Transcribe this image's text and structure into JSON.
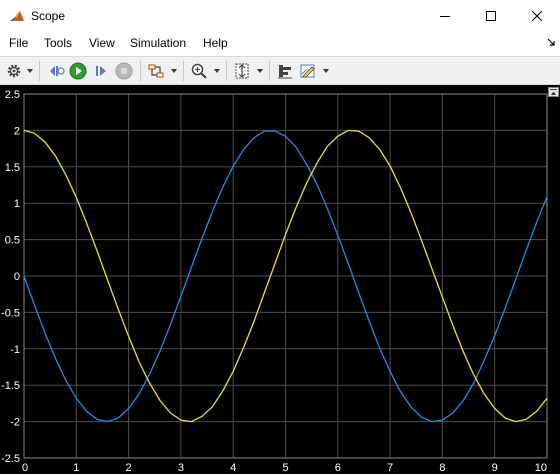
{
  "window": {
    "title": "Scope",
    "icon": "matlab-scope-icon",
    "controls": [
      "minimize-icon",
      "maximize-icon",
      "close-icon"
    ]
  },
  "menu": {
    "items": [
      {
        "label": "File"
      },
      {
        "label": "Tools"
      },
      {
        "label": "View"
      },
      {
        "label": "Simulation"
      },
      {
        "label": "Help"
      }
    ]
  },
  "toolbar": {
    "buttons": [
      {
        "icon": "gear-icon",
        "has_dropdown": true
      },
      {
        "icon": "step-back-icon"
      },
      {
        "icon": "run-icon",
        "color": "#2e9e2e"
      },
      {
        "icon": "step-forward-icon"
      },
      {
        "icon": "stop-icon",
        "enabled": false
      },
      {
        "icon": "signal-highlight-icon",
        "has_dropdown": true
      },
      {
        "icon": "zoom-icon",
        "has_dropdown": true
      },
      {
        "icon": "scale-axes-icon",
        "has_dropdown": true
      },
      {
        "icon": "cursor-measurements-icon"
      },
      {
        "icon": "style-edit-icon",
        "has_dropdown": true
      }
    ]
  },
  "colors": {
    "background": "#000000",
    "grid": "#4d4d4d",
    "axis_text": "#ffffff",
    "series_1": "#1e8ee6",
    "series_2": "#e6e62e"
  },
  "chart_data": {
    "type": "line",
    "xlim": [
      0,
      10
    ],
    "ylim": [
      -2.5,
      2.5
    ],
    "xticks": [
      "0",
      "1",
      "2",
      "3",
      "4",
      "5",
      "6",
      "7",
      "8",
      "9",
      "10"
    ],
    "yticks": [
      "2.5",
      "2",
      "1.5",
      "1",
      "0.5",
      "0",
      "-0.5",
      "-1",
      "-1.5",
      "-2",
      "-2.5"
    ],
    "grid": true,
    "series": [
      {
        "color": "#1e8ee6",
        "x": [
          0,
          0.2,
          0.4,
          0.6,
          0.8,
          1,
          1.2,
          1.4,
          1.6,
          1.8,
          2,
          2.2,
          2.4,
          2.6,
          2.8,
          3,
          3.2,
          3.4,
          3.6,
          3.8,
          4,
          4.2,
          4.4,
          4.6,
          4.8,
          5,
          5.2,
          5.4,
          5.6,
          5.8,
          6,
          6.2,
          6.4,
          6.6,
          6.8,
          7,
          7.2,
          7.4,
          7.6,
          7.8,
          8,
          8.2,
          8.4,
          8.6,
          8.8,
          9,
          9.2,
          9.4,
          9.6,
          9.8,
          10
        ],
        "y": [
          0,
          -0.4,
          -0.78,
          -1.13,
          -1.43,
          -1.68,
          -1.86,
          -1.97,
          -2,
          -1.95,
          -1.82,
          -1.62,
          -1.35,
          -1.03,
          -0.67,
          -0.28,
          0.12,
          0.51,
          0.88,
          1.22,
          1.51,
          1.74,
          1.9,
          1.99,
          1.99,
          1.92,
          1.77,
          1.54,
          1.26,
          0.93,
          0.56,
          0.17,
          -0.23,
          -0.62,
          -0.99,
          -1.31,
          -1.59,
          -1.8,
          -1.94,
          -2,
          -1.98,
          -1.88,
          -1.71,
          -1.47,
          -1.16,
          -0.82,
          -0.44,
          -0.05,
          0.35,
          0.73,
          1.09
        ]
      },
      {
        "color": "#e6e62e",
        "x": [
          0,
          0.2,
          0.4,
          0.6,
          0.8,
          1,
          1.2,
          1.4,
          1.6,
          1.8,
          2,
          2.2,
          2.4,
          2.6,
          2.8,
          3,
          3.2,
          3.4,
          3.6,
          3.8,
          4,
          4.2,
          4.4,
          4.6,
          4.8,
          5,
          5.2,
          5.4,
          5.6,
          5.8,
          6,
          6.2,
          6.4,
          6.6,
          6.8,
          7,
          7.2,
          7.4,
          7.6,
          7.8,
          8,
          8.2,
          8.4,
          8.6,
          8.8,
          9,
          9.2,
          9.4,
          9.6,
          9.8,
          10
        ],
        "y": [
          2,
          1.96,
          1.84,
          1.65,
          1.39,
          1.08,
          0.72,
          0.34,
          -0.06,
          -0.45,
          -0.83,
          -1.18,
          -1.47,
          -1.71,
          -1.88,
          -1.98,
          -2,
          -1.93,
          -1.8,
          -1.58,
          -1.31,
          -0.98,
          -0.62,
          -0.22,
          0.17,
          0.57,
          0.94,
          1.27,
          1.55,
          1.78,
          1.92,
          2,
          1.99,
          1.9,
          1.74,
          1.51,
          1.21,
          0.87,
          0.49,
          0.1,
          -0.29,
          -0.68,
          -1.04,
          -1.36,
          -1.62,
          -1.82,
          -1.95,
          -2,
          -1.97,
          -1.86,
          -1.68
        ]
      }
    ]
  }
}
